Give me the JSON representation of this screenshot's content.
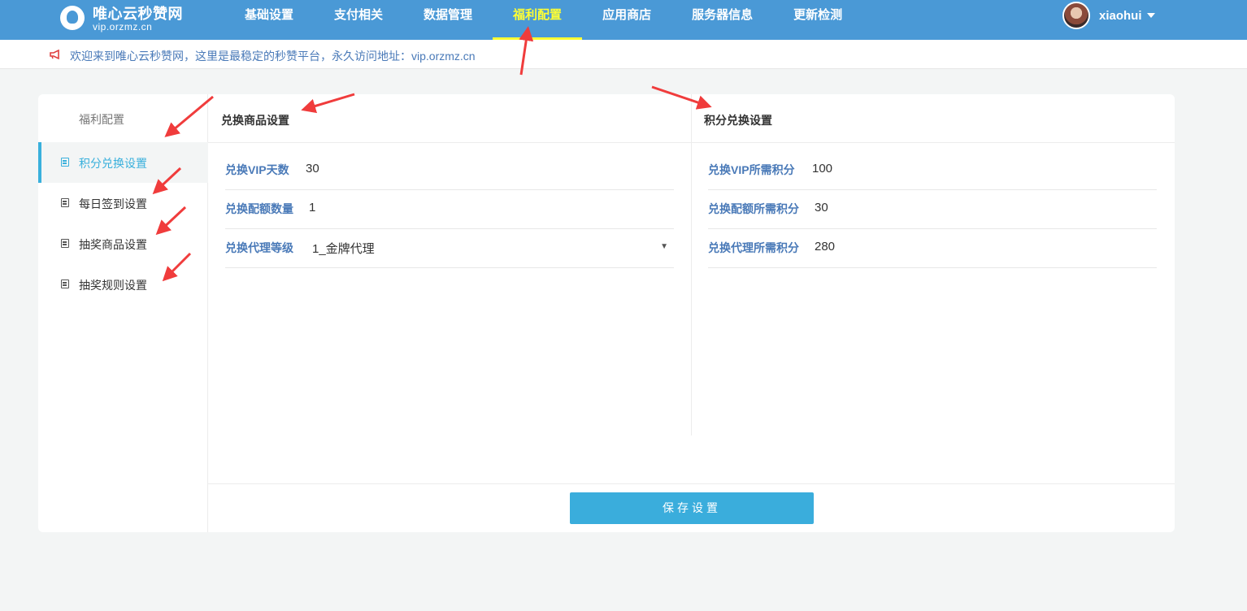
{
  "header": {
    "site_title": "唯心云秒赞网",
    "site_url": "vip.orzmz.cn",
    "nav": [
      {
        "label": "基础设置"
      },
      {
        "label": "支付相关"
      },
      {
        "label": "数据管理"
      },
      {
        "label": "福利配置",
        "active": true
      },
      {
        "label": "应用商店"
      },
      {
        "label": "服务器信息"
      },
      {
        "label": "更新检测"
      }
    ],
    "username": "xiaohui"
  },
  "notice": {
    "icon": "megaphone-icon",
    "text": "欢迎来到唯心云秒赞网，这里是最稳定的秒赞平台，永久访问地址：vip.orzmz.cn"
  },
  "sidebar": {
    "heading": "福利配置",
    "items": [
      {
        "label": "积分兑换设置",
        "active": true
      },
      {
        "label": "每日签到设置"
      },
      {
        "label": "抽奖商品设置"
      },
      {
        "label": "抽奖规则设置"
      }
    ]
  },
  "left_panel": {
    "title": "兑换商品设置",
    "fields": [
      {
        "label": "兑换VIP天数",
        "value": "30"
      },
      {
        "label": "兑换配额数量",
        "value": "1"
      },
      {
        "label": "兑换代理等级",
        "value": "1_金牌代理",
        "type": "select"
      }
    ]
  },
  "right_panel": {
    "title": "积分兑换设置",
    "fields": [
      {
        "label": "兑换VIP所需积分",
        "value": "100"
      },
      {
        "label": "兑换配额所需积分",
        "value": "30"
      },
      {
        "label": "兑换代理所需积分",
        "value": "280"
      }
    ]
  },
  "actions": {
    "save_label": "保存设置"
  },
  "colors": {
    "nav_bg": "#4a99d6",
    "nav_active": "#ffff33",
    "accent": "#39b0dc",
    "label_blue": "#4a7ab8",
    "annotation_arrow": "#f03c3c"
  }
}
